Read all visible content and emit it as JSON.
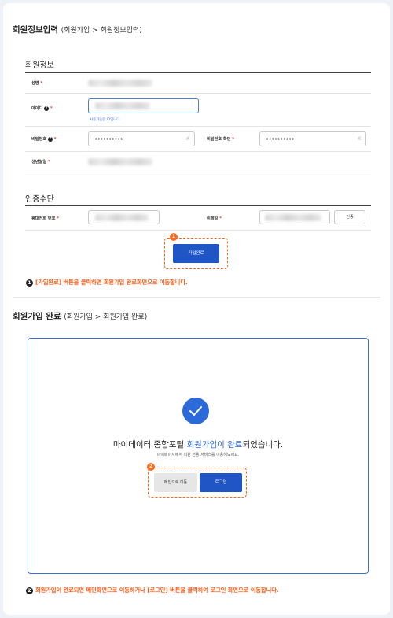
{
  "section1": {
    "title": "회원정보입력",
    "breadcrumb": "(회원가입 > 회원정보입력)",
    "member_group": "회원정보",
    "fields": {
      "name_label": "성명",
      "id_label": "아이디",
      "id_hint": "사용가능한 ID입니다.",
      "password_label": "비밀번호",
      "password_value": "••••••••••",
      "password_confirm_label": "비밀번호 확인",
      "password_confirm_value": "••••••••••",
      "birth_label": "생년월일"
    },
    "required_mark": "*",
    "help_mark": "?",
    "auth_group": "인증수단",
    "auth": {
      "phone_label": "휴대전화 번호",
      "email_label": "이메일",
      "verify_button": "인증"
    },
    "submit_button": "가입완료",
    "badge": "1"
  },
  "note1": {
    "num": "1",
    "text": "[가입완료] 버튼을 클릭하면 회원가입 완료화면으로 이동합니다."
  },
  "section2": {
    "title": "회원가입 완료",
    "breadcrumb": "(회원가입 > 회원가입 완료)",
    "message_part1": "마이데이터 종합포털 ",
    "message_highlight": "회원가입이 완료",
    "message_part2": "되었습니다.",
    "submessage": "마이페이지에서 회원 전용 서비스를 이용해보세요.",
    "main_button": "메인으로 이동",
    "login_button": "로그인",
    "badge": "2"
  },
  "note2": {
    "num": "2",
    "text": "회원가입이 완료되면 메인화면으로 이동하거나 [로그인] 버튼을 클릭하여 로그인 화면으로 이동합니다."
  },
  "colors": {
    "accent_blue": "#1f55c4",
    "highlight_orange": "#ff6a1a",
    "required_red": "#e53935"
  }
}
